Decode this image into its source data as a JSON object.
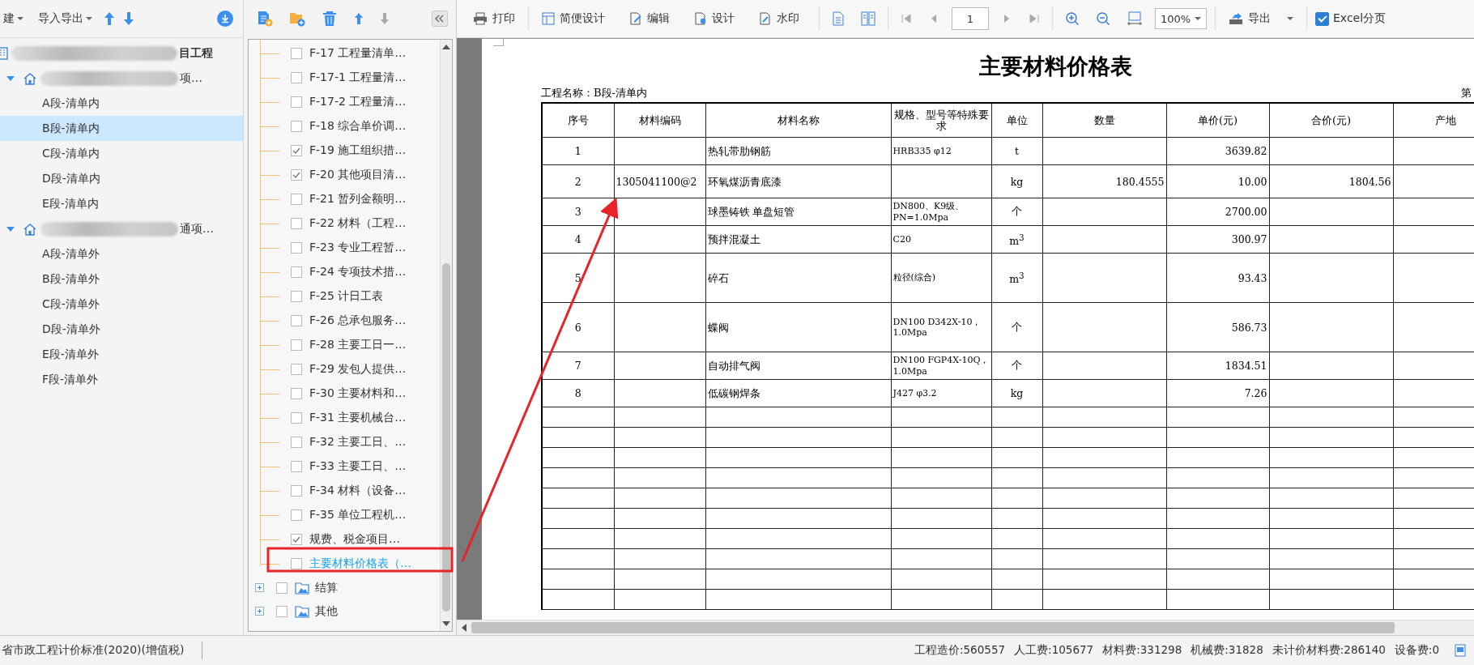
{
  "left_toolbar": {
    "menus": [
      "建",
      "导入导出"
    ]
  },
  "project_tree": [
    {
      "label": "目工程",
      "children": [
        {
          "label": "项…",
          "expanded": true,
          "children": [
            {
              "label": "A段-清单内",
              "selected": false
            },
            {
              "label": "B段-清单内",
              "selected": true
            },
            {
              "label": "C段-清单内",
              "selected": false
            },
            {
              "label": "D段-清单内",
              "selected": false
            },
            {
              "label": "E段-清单内",
              "selected": false
            }
          ]
        },
        {
          "label": "通项…",
          "expanded": true,
          "children": [
            {
              "label": "A段-清单外",
              "selected": false
            },
            {
              "label": "B段-清单外",
              "selected": false
            },
            {
              "label": "C段-清单外",
              "selected": false
            },
            {
              "label": "D段-清单外",
              "selected": false
            },
            {
              "label": "E段-清单外",
              "selected": false
            },
            {
              "label": "F段-清单外",
              "selected": false
            }
          ]
        }
      ]
    }
  ],
  "report_tree": {
    "items": [
      {
        "label": "F-17 工程量清单…",
        "checked": false,
        "selected": false
      },
      {
        "label": "F-17-1 工程量清…",
        "checked": false,
        "selected": false
      },
      {
        "label": "F-17-2 工程量清…",
        "checked": false,
        "selected": false
      },
      {
        "label": "F-18 综合单价调…",
        "checked": false,
        "selected": false
      },
      {
        "label": "F-19 施工组织措…",
        "checked": true,
        "selected": false
      },
      {
        "label": "F-20 其他项目清…",
        "checked": true,
        "selected": false
      },
      {
        "label": "F-21 暂列金额明…",
        "checked": false,
        "selected": false
      },
      {
        "label": "F-22 材料（工程…",
        "checked": false,
        "selected": false
      },
      {
        "label": "F-23 专业工程暂…",
        "checked": false,
        "selected": false
      },
      {
        "label": "F-24 专项技术措…",
        "checked": false,
        "selected": false
      },
      {
        "label": "F-25 计日工表",
        "checked": false,
        "selected": false
      },
      {
        "label": "F-26 总承包服务…",
        "checked": false,
        "selected": false
      },
      {
        "label": "F-28 主要工日一…",
        "checked": false,
        "selected": false
      },
      {
        "label": "F-29 发包人提供…",
        "checked": false,
        "selected": false
      },
      {
        "label": "F-30 主要材料和…",
        "checked": false,
        "selected": false
      },
      {
        "label": "F-31 主要机械台…",
        "checked": false,
        "selected": false
      },
      {
        "label": "F-32 主要工日、…",
        "checked": false,
        "selected": false
      },
      {
        "label": "F-33 主要工日、…",
        "checked": false,
        "selected": false
      },
      {
        "label": "F-34 材料（设备…",
        "checked": false,
        "selected": false
      },
      {
        "label": "F-35 单位工程机…",
        "checked": false,
        "selected": false
      },
      {
        "label": "规费、税金项目…",
        "checked": true,
        "selected": false
      },
      {
        "label": "主要材料价格表（…",
        "checked": false,
        "selected": true
      }
    ],
    "groups": [
      {
        "label": "结算",
        "checked": false
      },
      {
        "label": "其他",
        "checked": false
      }
    ]
  },
  "toolbar": {
    "buttons": [
      "打印",
      "简便设计",
      "编辑",
      "设计",
      "水印"
    ],
    "page": "1",
    "zoom": "100%",
    "export": "导出",
    "excel": {
      "label": "Excel分页",
      "checked": true
    }
  },
  "report": {
    "title": "主要材料价格表",
    "project_name": "工程名称：B段-清单内",
    "page_label": "第",
    "columns": [
      "序号",
      "材料编码",
      "材料名称",
      "规格、型号等特殊要求",
      "单位",
      "数量",
      "单价(元)",
      "合价(元)",
      "产地"
    ],
    "rows": [
      [
        "1",
        "",
        "热轧带肋钢筋",
        "HRB335 φ12",
        "t",
        "",
        "3639.82",
        "",
        ""
      ],
      [
        "2",
        "1305041100@2",
        "环氧煤沥青底漆",
        "",
        "kg",
        "180.4555",
        "10.00",
        "1804.56",
        ""
      ],
      [
        "3",
        "",
        "球墨铸铁 单盘短管",
        "DN800、K9级、PN=1.0Mpa",
        "个",
        "",
        "2700.00",
        "",
        ""
      ],
      [
        "4",
        "",
        "预拌混凝土",
        "C20",
        "m$^{3}$",
        "",
        "300.97",
        "",
        ""
      ],
      [
        "5",
        "",
        "碎石",
        "粒径(综合)",
        "m$^{3}$",
        "",
        "93.43",
        "",
        ""
      ],
      [
        "6",
        "",
        "蝶阀",
        "DN100 D342X-10，1.0Mpa",
        "个",
        "",
        "586.73",
        "",
        ""
      ],
      [
        "7",
        "",
        "自动排气阀",
        "DN100 FGP4X-10Q，1.0Mpa",
        "个",
        "",
        "1834.51",
        "",
        ""
      ],
      [
        "8",
        "",
        "低碳钢焊条",
        "J427 φ3.2",
        "kg",
        "",
        "7.26",
        "",
        ""
      ]
    ]
  },
  "status_bar": {
    "standard": "省市政工程计价标准(2020)(增值税)",
    "totals": [
      "工程造价:560557",
      "人工费:105677",
      "材料费:331298",
      "机械费:31828",
      "未计价材料费:286140",
      "设备费:0"
    ]
  }
}
